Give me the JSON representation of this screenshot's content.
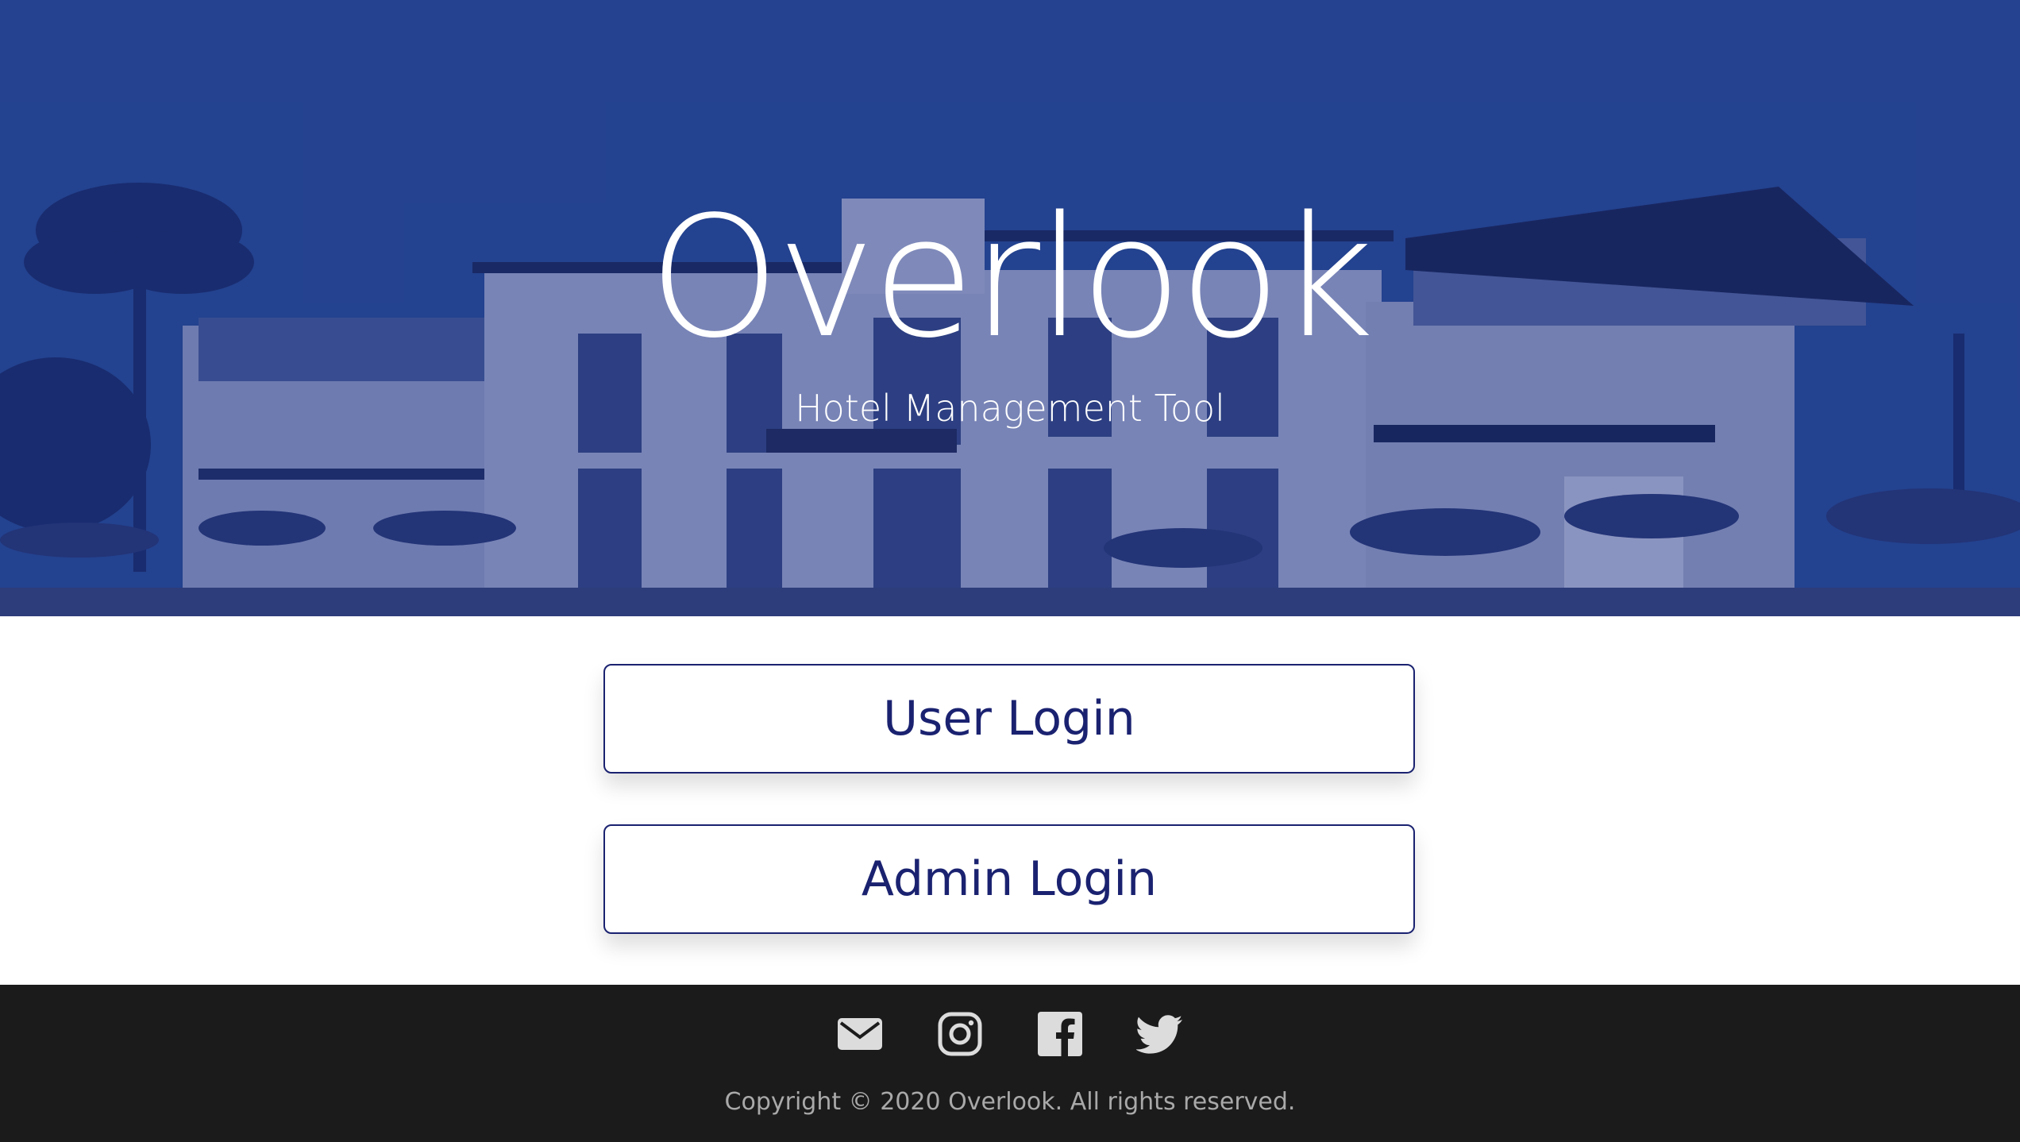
{
  "hero": {
    "title": "Overlook",
    "subtitle": "Hotel Management Tool"
  },
  "login": {
    "user_label": "User Login",
    "admin_label": "Admin Login"
  },
  "footer": {
    "icons": [
      "email-icon",
      "instagram-icon",
      "facebook-icon",
      "twitter-icon"
    ],
    "copyright": "Copyright © 2020 Overlook. All rights reserved."
  },
  "colors": {
    "accent": "#1a2270",
    "footer_bg": "#1b1b1b",
    "hero_tint": "#2a4f96"
  }
}
